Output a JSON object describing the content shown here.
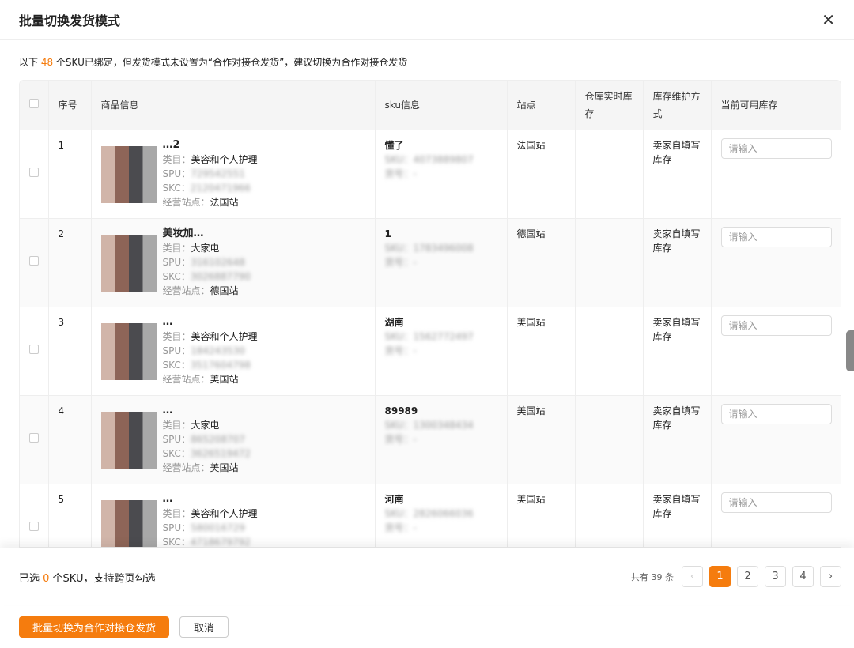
{
  "title": "批量切换发货模式",
  "notice": {
    "prefix": "以下 ",
    "count": "48",
    "suffix": " 个SKU已绑定，但发货模式未设置为“合作对接仓发货”，建议切换为合作对接仓发货"
  },
  "columns": [
    "序号",
    "商品信息",
    "sku信息",
    "站点",
    "仓库实时库存",
    "库存维护方式",
    "当前可用库存"
  ],
  "labels": {
    "category": "类目：",
    "spu": "SPU：",
    "skc": "SKC：",
    "site": "经营站点：",
    "sku": "SKU：",
    "code": "货号："
  },
  "rows": [
    {
      "no": "1",
      "title": "…2",
      "category": "美容和个人护理",
      "spu": "729542551",
      "skc": "2120471966",
      "site": "法国站",
      "sku_name": "懂了",
      "sku": "4073889807",
      "code": "-",
      "station": "法国站",
      "warehouse": "",
      "maintain": "卖家自填写库存",
      "placeholder": "请输入"
    },
    {
      "no": "2",
      "title": "美妆加…",
      "category": "大家电",
      "spu": "316102648",
      "skc": "3026887790",
      "site": "德国站",
      "sku_name": "1",
      "sku": "1783496008",
      "code": "-",
      "station": "德国站",
      "warehouse": "",
      "maintain": "卖家自填写库存",
      "placeholder": "请输入"
    },
    {
      "no": "3",
      "title": "…",
      "category": "美容和个人护理",
      "spu": "184243530",
      "skc": "3517604798",
      "site": "美国站",
      "sku_name": "湖南",
      "sku": "1562772497",
      "code": "-",
      "station": "美国站",
      "warehouse": "",
      "maintain": "卖家自填写库存",
      "placeholder": "请输入"
    },
    {
      "no": "4",
      "title": "…",
      "category": "大家电",
      "spu": "865208707",
      "skc": "3626519472",
      "site": "美国站",
      "sku_name": "89989",
      "sku": "1300348434",
      "code": "-",
      "station": "美国站",
      "warehouse": "",
      "maintain": "卖家自填写库存",
      "placeholder": "请输入"
    },
    {
      "no": "5",
      "title": "…",
      "category": "美容和个人护理",
      "spu": "580016729",
      "skc": "4718679792",
      "site": "",
      "sku_name": "河南",
      "sku": "2826066036",
      "code": "-",
      "station": "美国站",
      "warehouse": "",
      "maintain": "卖家自填写库存",
      "placeholder": "请输入"
    }
  ],
  "footer": {
    "sel_prefix": "已选 ",
    "sel_count": "0",
    "sel_suffix": " 个SKU，支持跨页勾选",
    "total": "共有 39 条",
    "pages": [
      "1",
      "2",
      "3",
      "4"
    ],
    "prev": "‹",
    "next": "›"
  },
  "actions": {
    "primary": "批量切换为合作对接仓发货",
    "cancel": "取消"
  },
  "colors": {
    "accent": "#f57c0e"
  }
}
